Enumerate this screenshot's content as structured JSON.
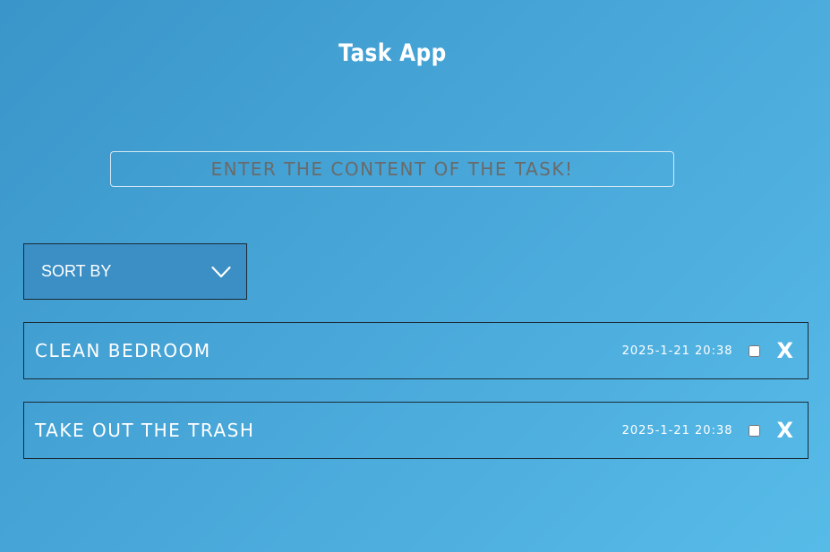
{
  "app": {
    "title": "Task App"
  },
  "input": {
    "placeholder": "ENTER THE CONTENT OF THE TASK!",
    "value": ""
  },
  "sort": {
    "label": "SORT BY",
    "icon": "chevron-down-icon"
  },
  "tasks": [
    {
      "text": "CLEAN BEDROOM",
      "date": "2025-1-21 20:38",
      "completed": false,
      "delete_label": "X"
    },
    {
      "text": "TAKE OUT THE TRASH",
      "date": "2025-1-21 20:38",
      "completed": false,
      "delete_label": "X"
    }
  ],
  "colors": {
    "background_start": "#3a95c9",
    "background_end": "#57bbe8",
    "text": "#ffffff",
    "placeholder": "#6a6a6a",
    "border": "#1a2a36"
  }
}
